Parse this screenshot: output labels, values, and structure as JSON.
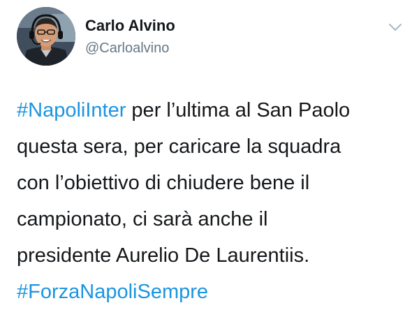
{
  "author": {
    "name": "Carlo Alvino",
    "handle": "@Carloalvino"
  },
  "icons": {
    "menu": "chevron-down-icon",
    "avatar": "profile-photo"
  },
  "colors": {
    "hashtag": "#1b95e0",
    "text": "#14171a",
    "secondary": "#657786"
  },
  "tweet": {
    "lines": [
      {
        "hashtag": "#NapoliInter",
        "text": " per l’ultima al San Paolo"
      },
      {
        "text": "questa sera, per caricare la squadra"
      },
      {
        "text": "con l’obiettivo di chiudere bene il"
      },
      {
        "text": "campionato, ci sarà anche il"
      },
      {
        "text": "presidente Aurelio De Laurentiis."
      },
      {
        "hashtag": "#ForzaNapoliSempre"
      }
    ]
  }
}
